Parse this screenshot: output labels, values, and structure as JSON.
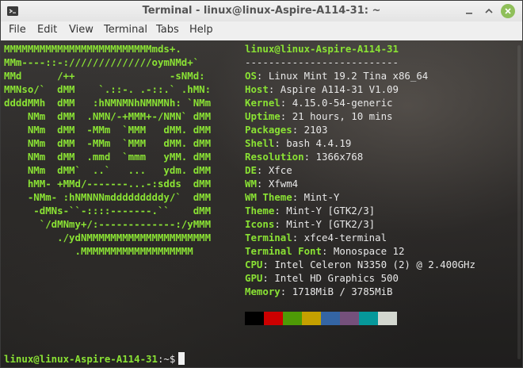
{
  "window": {
    "title": "Terminal - linux@linux-Aspire-A114-31: ~"
  },
  "menu": {
    "items": [
      "File",
      "Edit",
      "View",
      "Terminal",
      "Tabs",
      "Help"
    ]
  },
  "logo_lines": [
    "MMMMMMMMMMMMMMMMMMMMMMMMMmds+.",
    "MMm----::-://////////////oymNMd+`",
    "MMd      /++                -sNMd:",
    "MMNso/`  dMM    `.::-. .-::.` .hMN:",
    "ddddMMh  dMM   :hNMNMNhNMNMNh: `NMm",
    "    NMm  dMM  .NMN/-+MMM+-/NMN` dMM",
    "    NMm  dMM  -MMm  `MMM   dMM. dMM",
    "    NMm  dMM  -MMm  `MMM   dMM. dMM",
    "    NMm  dMM  .mmd  `mmm   yMM. dMM",
    "    NMm  dMM`  ..`   ...   ydm. dMM",
    "    hMM- +MMd/-------...-:sdds  dMM",
    "    -NMm- :hNMNNNmdddddddddy/`  dMM",
    "     -dMNs-``-::::-------.``    dMM",
    "      `/dMNmy+/:-------------:/yMMM",
    "         ./ydNMMMMMMMMMMMMMMMMMMMMM",
    "            .MMMMMMMMMMMMMMMMMMM"
  ],
  "header": {
    "user_host": "linux@linux-Aspire-A114-31",
    "separator": "--------------------------"
  },
  "info": [
    {
      "label": "OS",
      "value": "Linux Mint 19.2 Tina x86_64"
    },
    {
      "label": "Host",
      "value": "Aspire A114-31 V1.09"
    },
    {
      "label": "Kernel",
      "value": "4.15.0-54-generic"
    },
    {
      "label": "Uptime",
      "value": "21 hours, 10 mins"
    },
    {
      "label": "Packages",
      "value": "2103"
    },
    {
      "label": "Shell",
      "value": "bash 4.4.19"
    },
    {
      "label": "Resolution",
      "value": "1366x768"
    },
    {
      "label": "DE",
      "value": "Xfce"
    },
    {
      "label": "WM",
      "value": "Xfwm4"
    },
    {
      "label": "WM Theme",
      "value": "Mint-Y"
    },
    {
      "label": "Theme",
      "value": "Mint-Y [GTK2/3]"
    },
    {
      "label": "Icons",
      "value": "Mint-Y [GTK2/3]"
    },
    {
      "label": "Terminal",
      "value": "xfce4-terminal"
    },
    {
      "label": "Terminal Font",
      "value": "Monospace 12"
    },
    {
      "label": "CPU",
      "value": "Intel Celeron N3350 (2) @ 2.400GHz"
    },
    {
      "label": "GPU",
      "value": "Intel HD Graphics 500"
    },
    {
      "label": "Memory",
      "value": "1718MiB / 3785MiB"
    }
  ],
  "color_blocks": [
    "#000000",
    "#cc0000",
    "#4e9a06",
    "#c4a000",
    "#3465a4",
    "#75507b",
    "#06989a",
    "#d3d7cf"
  ],
  "prompt": {
    "text": "linux@linux-Aspire-A114-31",
    "suffix": ":~$"
  },
  "colors": {
    "accent_green": "#8ae234",
    "text": "#e8e8e8"
  }
}
